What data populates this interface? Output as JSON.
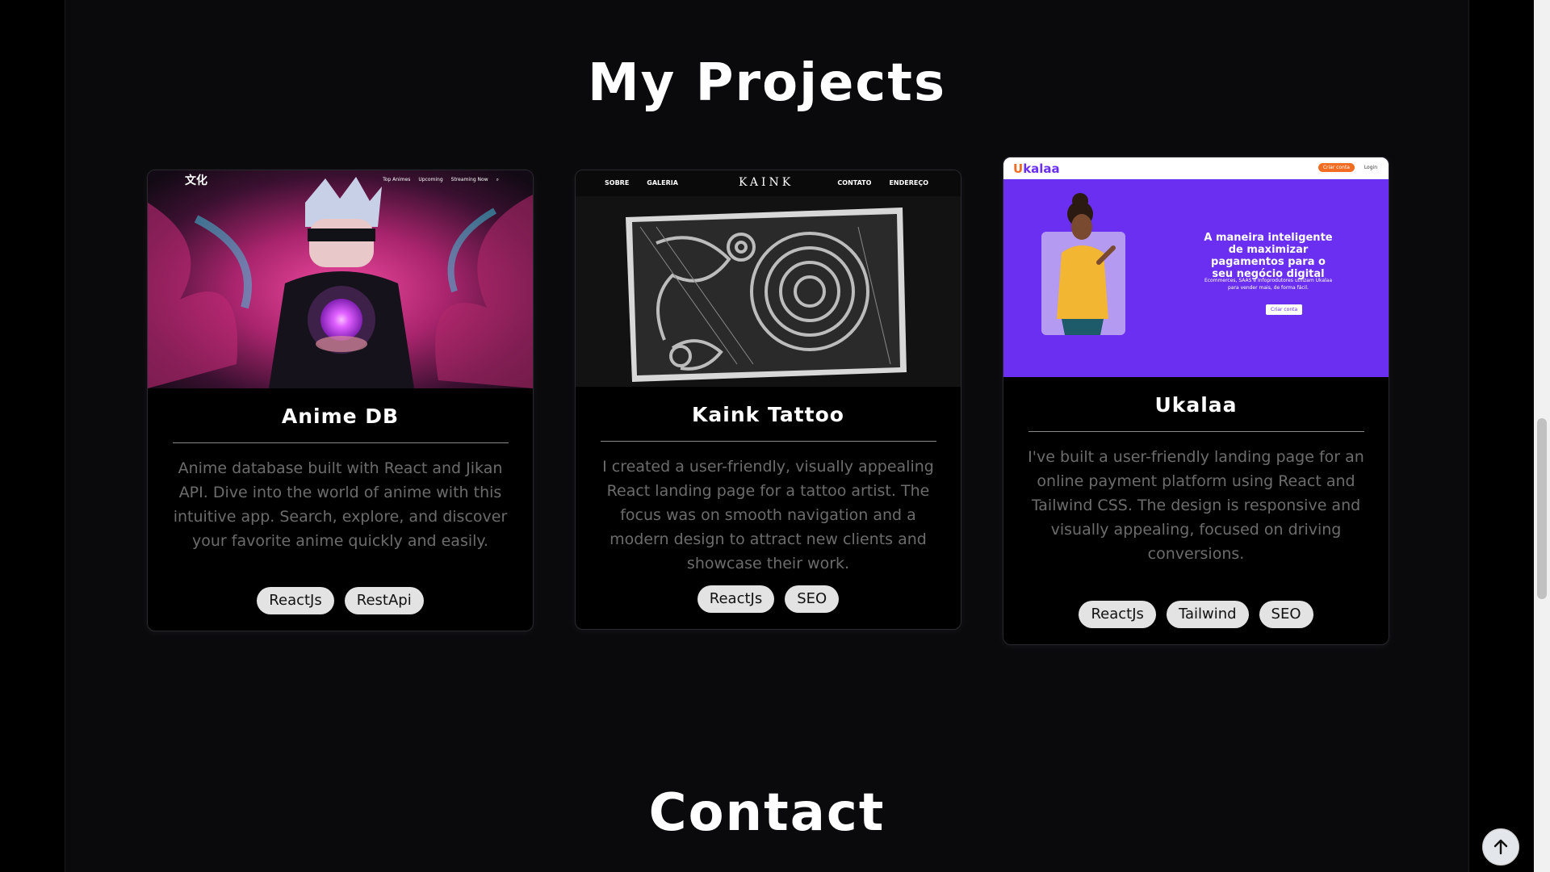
{
  "sections": {
    "projects_title": "My Projects",
    "contact_title": "Contact"
  },
  "projects": [
    {
      "title": "Anime DB",
      "description": "Anime database built with React and Jikan API. Dive into the world of anime with this intuitive app. Search, explore, and discover your favorite anime quickly and easily.",
      "tags": [
        "ReactJs",
        "RestApi"
      ],
      "preview": {
        "logo": "文化",
        "nav": [
          "Top Animes",
          "Upcoming",
          "Streaming Now"
        ],
        "icon": "search-icon"
      }
    },
    {
      "title": "Kaink Tattoo",
      "description": "I created a user-friendly, visually appealing React landing page for a tattoo artist. The focus was on smooth navigation and a modern design to attract new clients and showcase their work.",
      "tags": [
        "ReactJs",
        "SEO"
      ],
      "preview": {
        "logo": "KAINK",
        "nav_left": [
          "SOBRE",
          "GALERIA"
        ],
        "nav_right": [
          "CONTATO",
          "ENDEREÇO"
        ]
      }
    },
    {
      "title": "Ukalaa",
      "description": "I've built a user-friendly landing page for an online payment platform using React and Tailwind CSS. The design is responsive and visually appealing, focused on driving conversions.",
      "tags": [
        "ReactJs",
        "Tailwind",
        "SEO"
      ],
      "preview": {
        "logo_a": "U",
        "logo_b": "kalaa",
        "cta": "Criar conta",
        "login": "Login",
        "headline": "A maneira inteligente de maximizar pagamentos para o seu negócio digital",
        "sub": "Ecommerces, SAAS e Infoprodutores utilizam Ukalaa para vender mais, de forma fácil.",
        "button": "Criar conta"
      }
    }
  ],
  "colors": {
    "background": "#000000",
    "panel": "#0a0a0d",
    "ukalaa_purple": "#6a2ff0",
    "ukalaa_orange": "#f26d21",
    "anime_magenta": "#d0307a"
  }
}
